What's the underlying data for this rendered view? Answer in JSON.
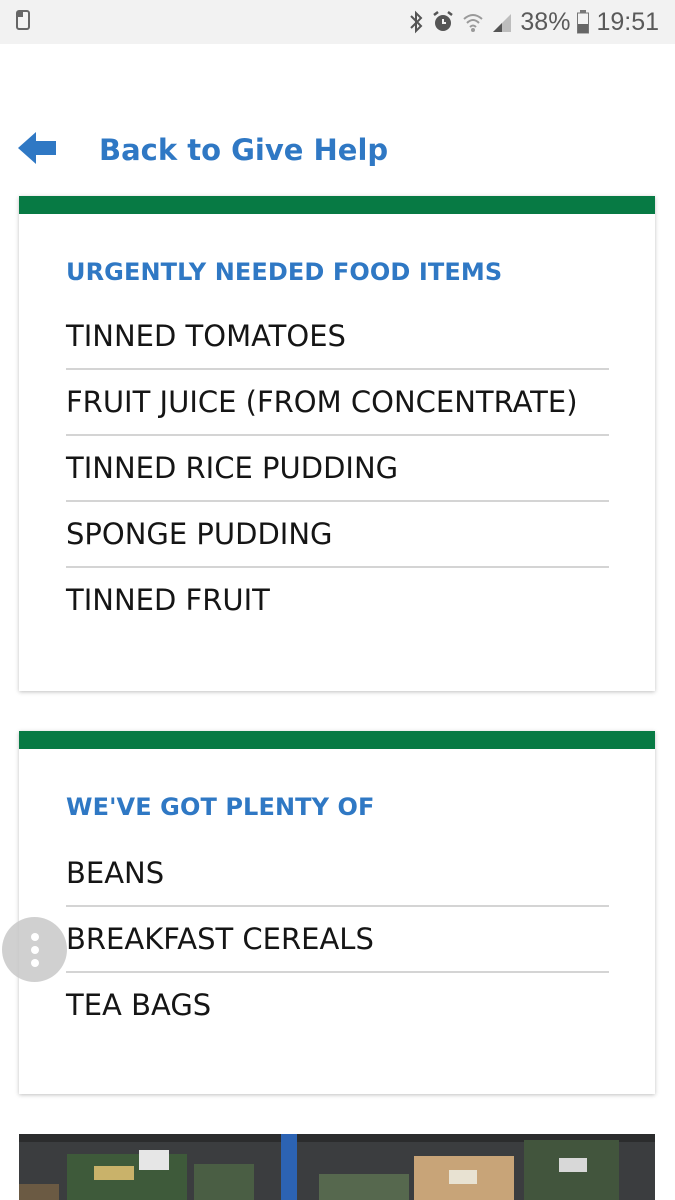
{
  "status_bar": {
    "battery": "38%",
    "time": "19:51",
    "icons": [
      "notification-icon",
      "bluetooth-icon",
      "alarm-icon",
      "wifi-icon",
      "signal-icon",
      "battery-icon"
    ]
  },
  "back_link": {
    "label": "Back to Give Help",
    "icon": "back-arrow-icon"
  },
  "urgent": {
    "title": "URGENTLY NEEDED FOOD ITEMS",
    "items": [
      "TINNED TOMATOES",
      "FRUIT JUICE (FROM CONCENTRATE)",
      "TINNED RICE PUDDING",
      "SPONGE PUDDING",
      "TINNED FRUIT"
    ]
  },
  "plenty": {
    "title": "WE'VE GOT PLENTY OF",
    "items": [
      "BEANS",
      "BREAKFAST CEREALS",
      "TEA BAGS"
    ]
  },
  "colors": {
    "accent_green": "#077a44",
    "link_blue": "#2f78c4",
    "status_bar_bg": "#f2f2f2"
  },
  "floating_menu": {
    "icon": "more-vertical-icon"
  },
  "photo": {
    "icon": "warehouse-photo"
  }
}
